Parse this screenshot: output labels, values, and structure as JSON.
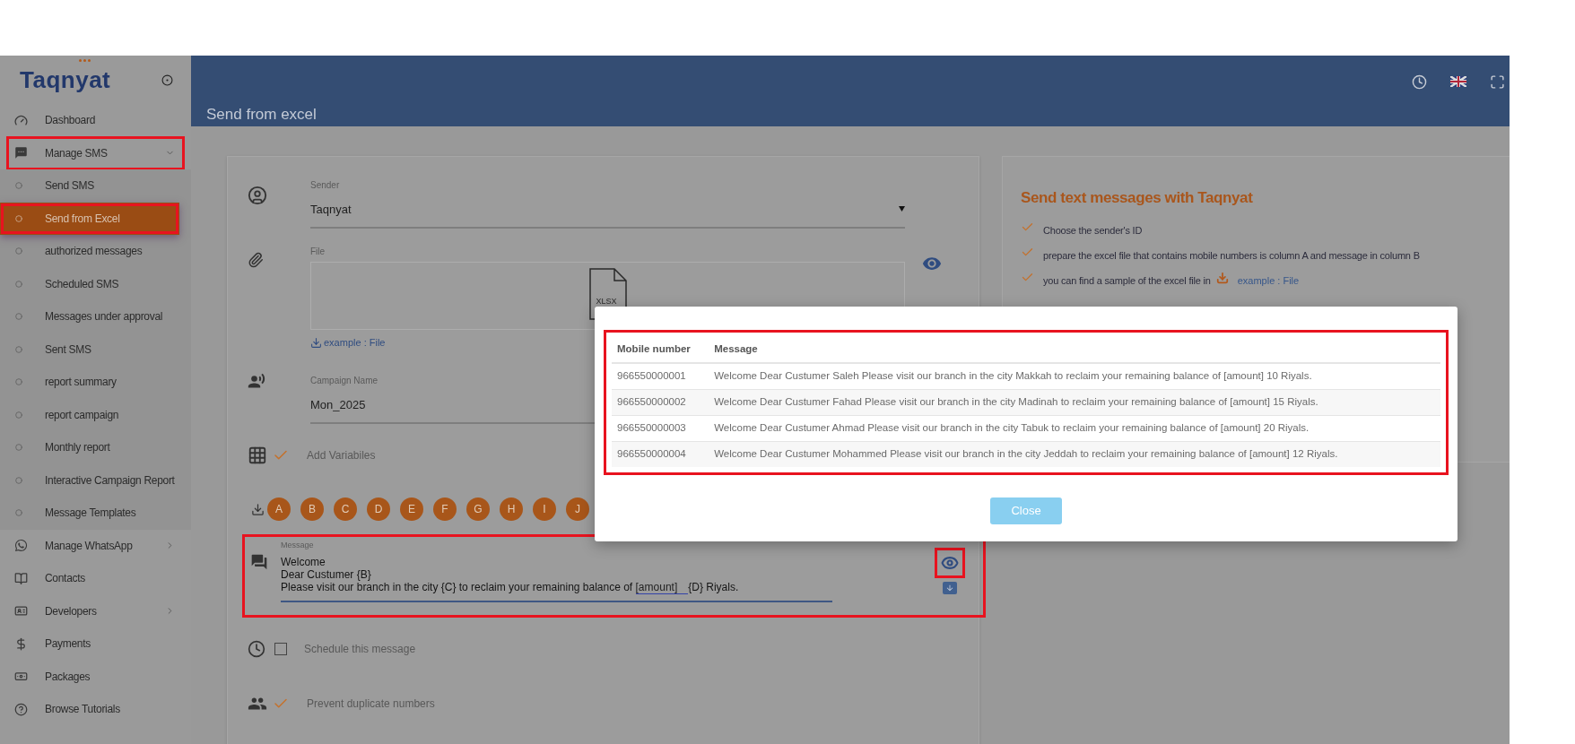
{
  "logo": {
    "text": "Taqnyat"
  },
  "sidebar": {
    "items": [
      {
        "label": "Dashboard",
        "kind": "link",
        "annotated": false
      },
      {
        "label": "Manage SMS",
        "kind": "group",
        "expanded": true,
        "annotated": true,
        "children": [
          {
            "label": "Send SMS",
            "selected": false,
            "annotated": false
          },
          {
            "label": "Send from Excel",
            "selected": true,
            "annotated": true
          },
          {
            "label": "authorized messages",
            "selected": false,
            "annotated": false
          },
          {
            "label": "Scheduled SMS",
            "selected": false,
            "annotated": false
          },
          {
            "label": "Messages under approval",
            "selected": false,
            "annotated": false
          },
          {
            "label": "Sent SMS",
            "selected": false,
            "annotated": false
          },
          {
            "label": "report summary",
            "selected": false,
            "annotated": false
          },
          {
            "label": "report campaign",
            "selected": false,
            "annotated": false
          },
          {
            "label": "Monthly report",
            "selected": false,
            "annotated": false
          },
          {
            "label": "Interactive Campaign Report",
            "selected": false,
            "annotated": false
          },
          {
            "label": "Message Templates",
            "selected": false,
            "annotated": false
          }
        ]
      },
      {
        "label": "Manage WhatsApp",
        "kind": "group",
        "expanded": false,
        "annotated": false
      },
      {
        "label": "Contacts",
        "kind": "link",
        "annotated": false
      },
      {
        "label": "Developers",
        "kind": "group",
        "expanded": false,
        "annotated": false
      },
      {
        "label": "Payments",
        "kind": "link",
        "annotated": false
      },
      {
        "label": "Packages",
        "kind": "link",
        "annotated": false
      },
      {
        "label": "Browse Tutorials",
        "kind": "link",
        "annotated": false
      }
    ]
  },
  "header": {
    "title": "Send from excel"
  },
  "form": {
    "sender": {
      "label": "Sender",
      "value": "Taqnyat"
    },
    "file": {
      "label": "File",
      "file_type": "XLSX",
      "link": "example : File"
    },
    "campaign": {
      "label": "Campaign Name",
      "value": "Mon_2025"
    },
    "variables": {
      "label": "Add Variabiles",
      "checked": true
    },
    "variable_buttons": [
      "A",
      "B",
      "C",
      "D",
      "E",
      "F",
      "G",
      "H",
      "I",
      "J"
    ],
    "message": {
      "label": "Message",
      "annotated": true,
      "preview_annotated": true,
      "lines": [
        {
          "text": "Welcome"
        },
        {
          "text": "Dear Custumer  {B}"
        },
        {
          "text": "Please visit our branch in the city {C} to reclaim your remaining balance of ",
          "link": "[amount]",
          "after": "{D} Riyals."
        }
      ]
    },
    "schedule": {
      "label": "Schedule this message",
      "checked": false
    },
    "prevent_duplicates": {
      "label": "Prevent duplicate numbers",
      "checked": true
    }
  },
  "info": {
    "title": "Send text messages with Taqnyat",
    "steps": [
      {
        "text": "Choose the sender's ID"
      },
      {
        "text": "prepare the excel file that contains mobile numbers is column A and message in column B"
      },
      {
        "text": "you can find a sample of the excel file in",
        "link": "example : File"
      }
    ]
  },
  "modal": {
    "annotated": true,
    "table": {
      "columns": [
        "Mobile number",
        "Message"
      ],
      "rows": [
        [
          "966550000001",
          "Welcome Dear Custumer Saleh Please visit our branch in the city Makkah to reclaim your remaining balance of [amount] 10 Riyals."
        ],
        [
          "966550000002",
          "Welcome Dear Custumer Fahad Please visit our branch in the city Madinah to reclaim your remaining balance of [amount] 15 Riyals."
        ],
        [
          "966550000003",
          "Welcome Dear Custumer Ahmad Please visit our branch in the city Tabuk to reclaim your remaining balance of [amount] 20 Riyals."
        ],
        [
          "966550000004",
          "Welcome Dear Custumer Mohammed Please visit our branch in the city Jeddah to reclaim your remaining balance of [amount] 12 Riyals."
        ]
      ]
    },
    "button": "Close"
  }
}
